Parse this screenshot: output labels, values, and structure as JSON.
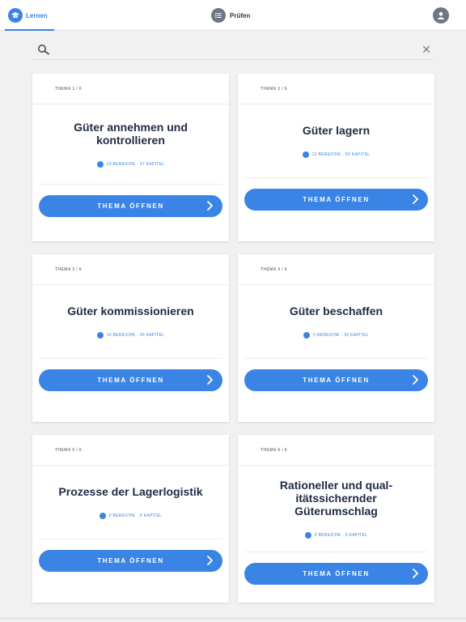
{
  "nav": {
    "lernen_label": "Lernen",
    "pruefen_label": "Prüfen",
    "accent_color": "#3a84e6"
  },
  "search": {
    "value": "",
    "placeholder": ""
  },
  "cards": [
    {
      "count": "THEMA 1 / 6",
      "title": "Güter annehmen und kontrollieren",
      "meta": "13 BEREICHE · 37 KAPITEL",
      "button": "THEMA ÖFFNEN"
    },
    {
      "count": "THEMA 2 / 6",
      "title": "Güter lagern",
      "meta": "12 BEREICHE · 53 KAPITEL",
      "button": "THEMA ÖFFNEN"
    },
    {
      "count": "THEMA 3 / 6",
      "title": "Güter kommissionieren",
      "meta": "10 BEREICHE · 26 KAPITEL",
      "button": "THEMA ÖFFNEN"
    },
    {
      "count": "THEMA 4 / 6",
      "title": "Güter beschaffen",
      "meta": "5 BEREICHE · 30 KAPITEL",
      "button": "THEMA ÖFFNEN"
    },
    {
      "count": "THEMA 5 / 6",
      "title": "Prozesse der Lagerlogistik",
      "meta": "0 BEREICHE · 0 KAPITEL",
      "button": "THEMA ÖFFNEN"
    },
    {
      "count": "THEMA 6 / 6",
      "title": "Rationeller und qual-itätssichernder Güterumschlag",
      "meta": "0 BEREICHE · 0 KAPITEL",
      "button": "THEMA ÖFFNEN"
    }
  ]
}
